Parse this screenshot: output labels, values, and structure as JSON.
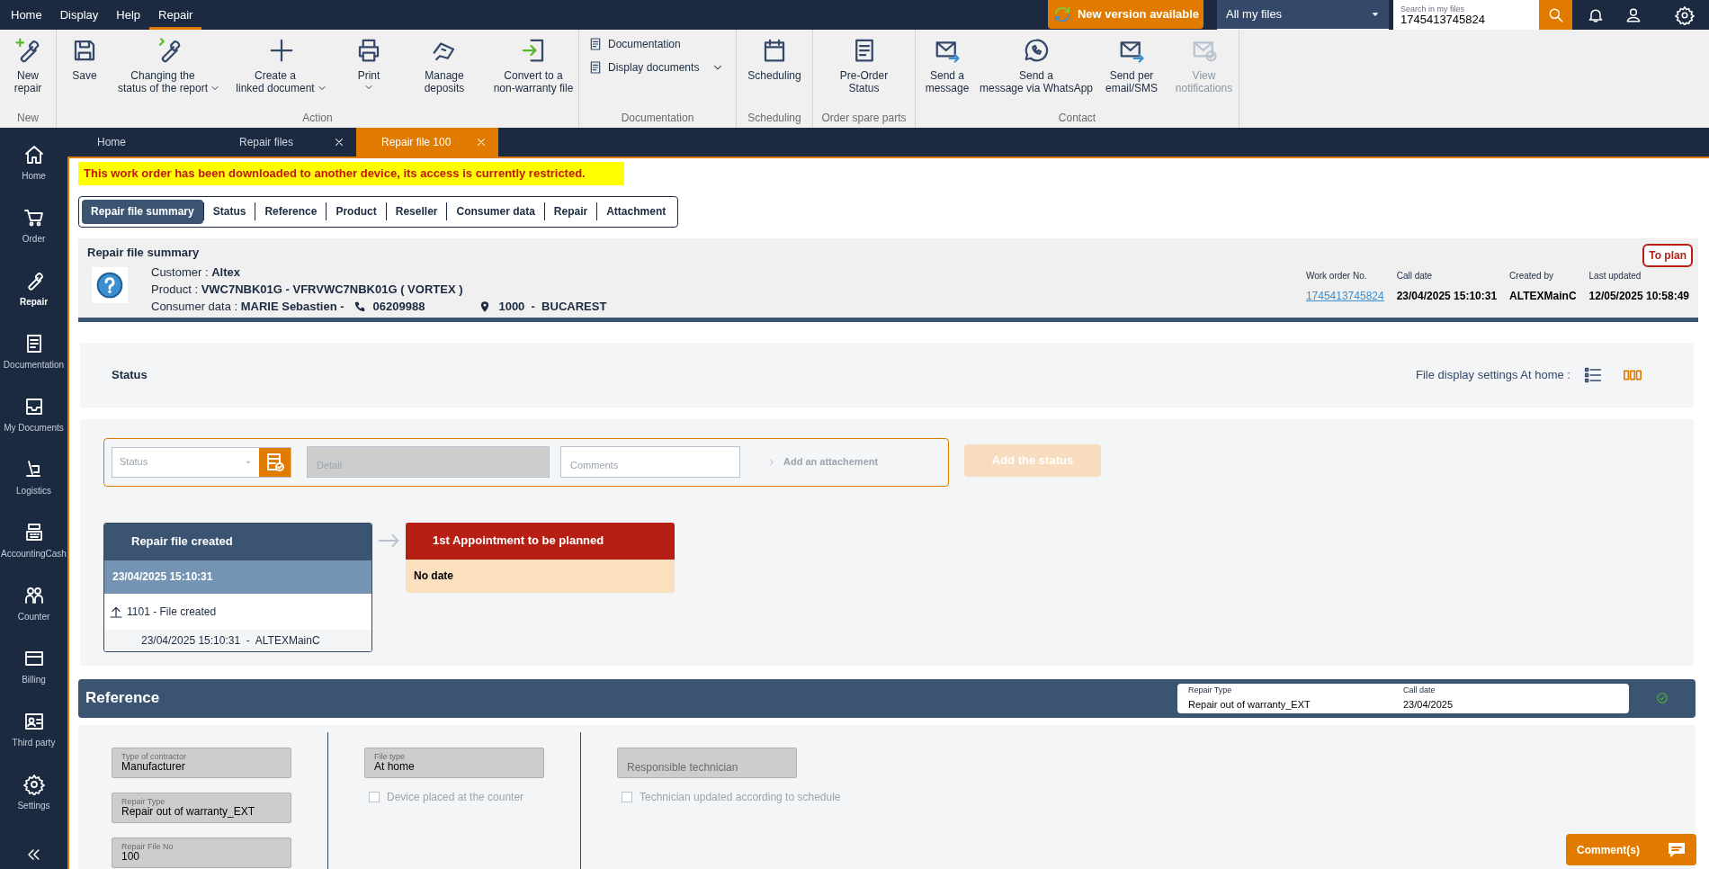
{
  "menu": [
    {
      "label": "Home",
      "selected": false
    },
    {
      "label": "Display",
      "selected": false
    },
    {
      "label": "Help",
      "selected": false
    },
    {
      "label": "Repair",
      "selected": true
    }
  ],
  "top_right": {
    "update_button": "New version available",
    "scope": "All my files",
    "search": {
      "label": "Search in my files",
      "value": "1745413745824"
    }
  },
  "ribbon": [
    {
      "title": "New",
      "kind": "large",
      "items": [
        {
          "label": "New\nrepair",
          "dropdown": false,
          "disabled": false
        }
      ]
    },
    {
      "title": "Action",
      "kind": "large",
      "items": [
        {
          "label": "Save",
          "dropdown": false,
          "disabled": false
        },
        {
          "label": "Changing the\nstatus of the report",
          "dropdown": true,
          "disabled": false
        },
        {
          "label": "Create a\nlinked document",
          "dropdown": true,
          "disabled": false
        },
        {
          "label": "Print",
          "dropdown": true,
          "disabled": false
        },
        {
          "label": "Manage\ndeposits",
          "dropdown": false,
          "disabled": false
        },
        {
          "label": "Convert to a\nnon-warranty file",
          "dropdown": false,
          "disabled": false
        }
      ]
    },
    {
      "title": "Documentation",
      "kind": "small",
      "items": [
        {
          "label": "Documentation",
          "dropdown": false,
          "disabled": false
        },
        {
          "label": "Display documents",
          "dropdown": true,
          "disabled": false
        }
      ]
    },
    {
      "title": "Scheduling",
      "kind": "large",
      "items": [
        {
          "label": "Scheduling",
          "dropdown": false,
          "disabled": false
        }
      ]
    },
    {
      "title": "Order spare parts",
      "kind": "large",
      "items": [
        {
          "label": "Pre-Order\nStatus",
          "dropdown": false,
          "disabled": false
        }
      ]
    },
    {
      "title": "Contact",
      "kind": "large",
      "items": [
        {
          "label": "Send a\nmessage",
          "dropdown": false,
          "disabled": false
        },
        {
          "label": "Send a\nmessage via WhatsApp",
          "dropdown": false,
          "disabled": false
        },
        {
          "label": "Send per\nemail/SMS",
          "dropdown": false,
          "disabled": false
        },
        {
          "label": "View\nnotifications",
          "dropdown": false,
          "disabled": true
        }
      ]
    }
  ],
  "sidebar": [
    {
      "label": "Home",
      "selected": false
    },
    {
      "label": "Order",
      "selected": false
    },
    {
      "label": "Repair",
      "selected": true
    },
    {
      "label": "Documentation",
      "selected": false
    },
    {
      "label": "My Documents",
      "selected": false
    },
    {
      "label": "Logistics",
      "selected": false
    },
    {
      "label": "AccountingCash",
      "selected": false
    },
    {
      "label": "Counter",
      "selected": false
    },
    {
      "label": "Billing",
      "selected": false
    },
    {
      "label": "Third party",
      "selected": false
    },
    {
      "label": "Settings",
      "selected": false
    }
  ],
  "tabs": [
    {
      "label": "Home",
      "closable": false,
      "selected": false
    },
    {
      "label": "Repair files",
      "closable": true,
      "selected": false
    },
    {
      "label": "Repair file 100",
      "closable": true,
      "selected": true
    }
  ],
  "warning": "This work order has been downloaded to another device, its access is currently restricted.",
  "section_tabs": [
    {
      "label": "Repair file summary",
      "selected": true
    },
    {
      "label": "Status",
      "selected": false
    },
    {
      "label": "Reference",
      "selected": false
    },
    {
      "label": "Product",
      "selected": false
    },
    {
      "label": "Reseller",
      "selected": false
    },
    {
      "label": "Consumer data",
      "selected": false
    },
    {
      "label": "Repair",
      "selected": false
    },
    {
      "label": "Attachment",
      "selected": false
    }
  ],
  "summary": {
    "title": "Repair file summary",
    "badge": "To plan",
    "customer": "Customer : **Altex**",
    "product": "Product : **VWC7NBK01G  -  VFRVWC7NBK01G ( VORTEX )**",
    "consumer": "Consumer data : **MARIE Sebastien -**",
    "phone": "06209988",
    "address": "1000  -  BUCAREST",
    "meta": [
      {
        "label": "Work order No.",
        "value": "1745413745824",
        "link": true
      },
      {
        "label": "Call date",
        "value": "23/04/2025 15:10:31",
        "link": false
      },
      {
        "label": "Created by",
        "value": "ALTEXMainC",
        "link": false
      },
      {
        "label": "Last updated",
        "value": "12/05/2025 10:58:49",
        "link": false
      }
    ]
  },
  "status": {
    "title": "Status",
    "display_label": "File display settings At home :",
    "views": [
      {
        "selected": false
      },
      {
        "selected": true
      }
    ],
    "form": {
      "status_placeholder": "Status",
      "detail_placeholder": "Detail",
      "comments_placeholder": "Comments",
      "attachment": "Add an attachement",
      "add_button": "Add the status",
      "add_disabled": true
    },
    "timeline": [
      {
        "title": "Repair file created",
        "kind": "done",
        "date": "23/04/2025 15:10:31",
        "events": [
          {
            "text": "1101 - File created",
            "meta": "23/04/2025 15:10:31  -  ALTEXMainC"
          }
        ]
      },
      {
        "title": "1st Appointment to be planned",
        "kind": "pending",
        "date": "No date"
      }
    ]
  },
  "reference": {
    "title": "Reference",
    "summary": [
      {
        "label": "Repair Type",
        "value": "Repair out of warranty_EXT"
      },
      {
        "label": "Call date",
        "value": "23/04/2025"
      }
    ],
    "columns": [
      [
        {
          "kind": "field",
          "label": "Type of contractor",
          "value": "Manufacturer"
        },
        {
          "kind": "field",
          "label": "Repair Type",
          "value": "Repair out of warranty_EXT"
        },
        {
          "kind": "field",
          "label": "Repair File No",
          "value": "100"
        }
      ],
      [
        {
          "kind": "field",
          "label": "File type",
          "value": "At home"
        },
        {
          "kind": "checkbox",
          "label": "Device placed at the counter",
          "checked": false
        }
      ],
      [
        {
          "kind": "empty_field",
          "placeholder": "Responsible technician"
        },
        {
          "kind": "checkbox",
          "label": "Technician updated according to schedule",
          "checked": false
        }
      ]
    ]
  },
  "comments_button": "Comment(s)"
}
